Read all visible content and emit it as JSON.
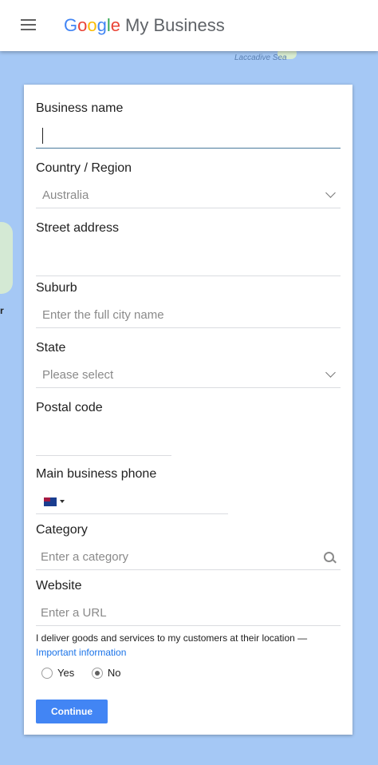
{
  "app": {
    "brand_letters": [
      "G",
      "o",
      "o",
      "g",
      "l",
      "e"
    ],
    "product": "My Business"
  },
  "map": {
    "sea_label": "Laccadive Sea",
    "edge_label": "r"
  },
  "form": {
    "business_name": {
      "label": "Business name",
      "value": ""
    },
    "country": {
      "label": "Country / Region",
      "value": "Australia"
    },
    "street": {
      "label": "Street address",
      "value": ""
    },
    "suburb": {
      "label": "Suburb",
      "placeholder": "Enter the full city name"
    },
    "state": {
      "label": "State",
      "value": "Please select"
    },
    "postal": {
      "label": "Postal code",
      "value": ""
    },
    "phone": {
      "label": "Main business phone",
      "value": ""
    },
    "category": {
      "label": "Category",
      "placeholder": "Enter a category"
    },
    "website": {
      "label": "Website",
      "placeholder": "Enter a URL"
    },
    "delivery_text": "I deliver goods and services to my customers at their location —",
    "important_link": "Important information",
    "yes_label": "Yes",
    "no_label": "No",
    "selected": "No",
    "continue_label": "Continue"
  },
  "colors": {
    "accent": "#4285f4",
    "link": "#1a73e8",
    "map_bg": "#a5c8f5"
  }
}
